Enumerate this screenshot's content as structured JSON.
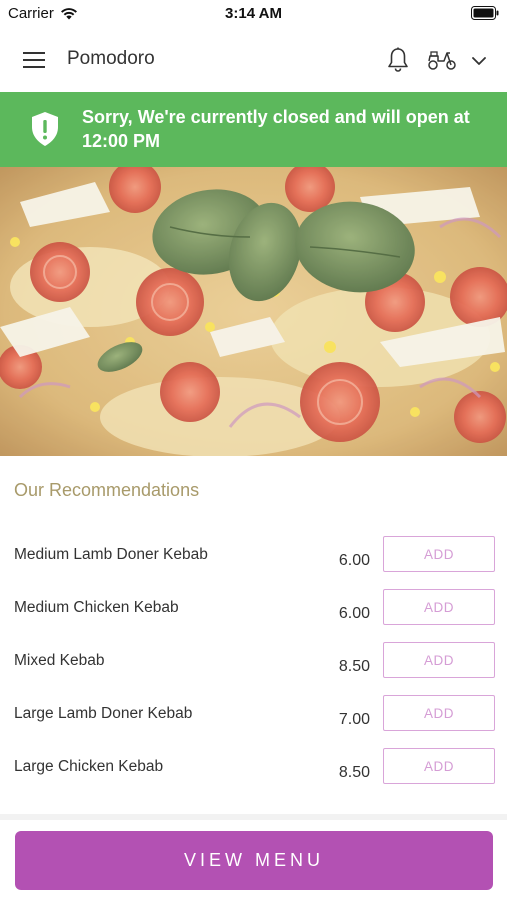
{
  "status_bar": {
    "carrier": "Carrier",
    "time": "3:14 AM"
  },
  "nav": {
    "title": "Pomodoro",
    "icons": [
      "menu-icon",
      "bell-icon",
      "scooter-icon",
      "chevron-down-icon"
    ]
  },
  "banner": {
    "message": "Sorry, We're currently closed and will open at 12:00 PM",
    "icon": "shield-alert-icon",
    "color": "#5cb85c"
  },
  "recommendations": {
    "title": "Our Recommendations",
    "add_label": "ADD",
    "items": [
      {
        "name": "Medium Lamb Doner Kebab",
        "price": "6.00"
      },
      {
        "name": "Medium Chicken Kebab",
        "price": "6.00"
      },
      {
        "name": "Mixed Kebab",
        "price": "8.50"
      },
      {
        "name": "Large Lamb Doner Kebab",
        "price": "7.00"
      },
      {
        "name": "Large Chicken Kebab",
        "price": "8.50"
      }
    ]
  },
  "footer": {
    "view_menu_label": "VIEW MENU",
    "accent": "#b351b3"
  }
}
